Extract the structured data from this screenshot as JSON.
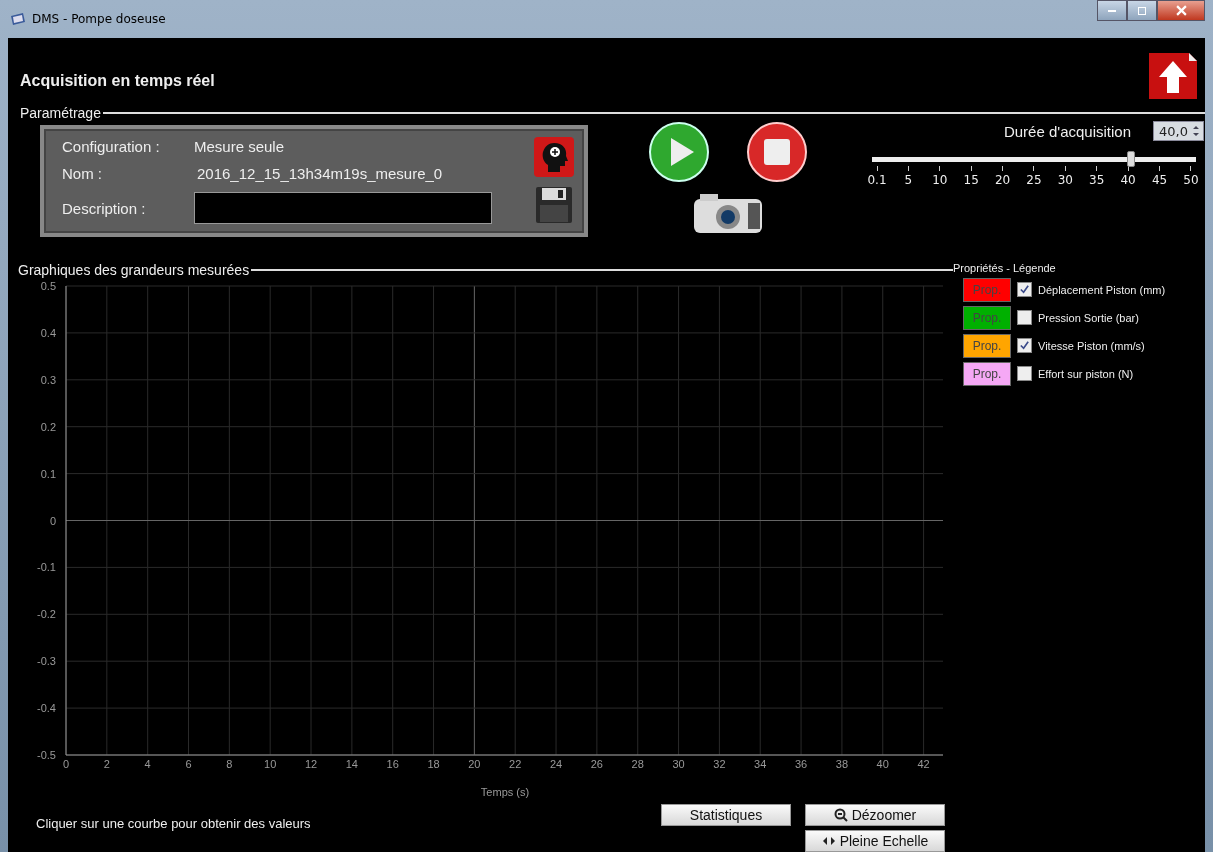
{
  "window": {
    "title": "DMS - Pompe doseuse"
  },
  "header": {
    "title": "Acquisition en temps réel"
  },
  "parametrage": {
    "legend": "Paramétrage",
    "fields": [
      {
        "label": "Configuration :",
        "value": "Mesure seule",
        "kind": "text"
      },
      {
        "label": "Nom :",
        "value": "2016_12_15_13h34m19s_mesure_0",
        "kind": "text"
      },
      {
        "label": "Description :",
        "kind": "input"
      }
    ],
    "duration": {
      "label": "Durée d'acquisition",
      "value": "40,0",
      "level": 0.8,
      "ticks": [
        "0.1",
        "5",
        "10",
        "15",
        "20",
        "25",
        "30",
        "35",
        "40",
        "45",
        "50"
      ]
    }
  },
  "graph": {
    "legend": "Graphiques des grandeurs mesurées",
    "chart_data": {
      "type": "line",
      "grid": true,
      "xlabel": "Temps (s)",
      "xlim": [
        0,
        43
      ],
      "ylim": [
        -0.5,
        0.5
      ],
      "xticks": [
        0,
        2,
        4,
        6,
        8,
        10,
        12,
        14,
        16,
        18,
        20,
        22,
        24,
        26,
        28,
        30,
        32,
        34,
        36,
        38,
        40,
        42
      ],
      "yticks": [
        -0.5,
        -0.4,
        -0.3,
        -0.2,
        -0.1,
        0,
        0.1,
        0.2,
        0.3,
        0.4,
        0.5
      ]
    }
  },
  "properties": {
    "title": "Propriétés - Légende",
    "items": [
      {
        "button_label": "Prop.",
        "label": "Déplacement Piston (mm)",
        "color": "#ff0000",
        "checked": true
      },
      {
        "button_label": "Prop.",
        "label": "Pression Sortie (bar)",
        "color": "#00b000",
        "checked": false
      },
      {
        "button_label": "Prop.",
        "label": "Vitesse Piston (mm/s)",
        "color": "#ffa500",
        "checked": true
      },
      {
        "button_label": "Prop.",
        "label": "Effort sur piston (N)",
        "color": "#f5a8f5",
        "checked": false
      }
    ]
  },
  "hint": "Cliquer sur une courbe pour obtenir des valeurs",
  "buttons": [
    {
      "label": "Statistiques",
      "kind": "plain"
    },
    {
      "label": "Dézoomer",
      "kind": "zoom"
    },
    {
      "label": "Pleine Echelle",
      "kind": "full"
    }
  ]
}
